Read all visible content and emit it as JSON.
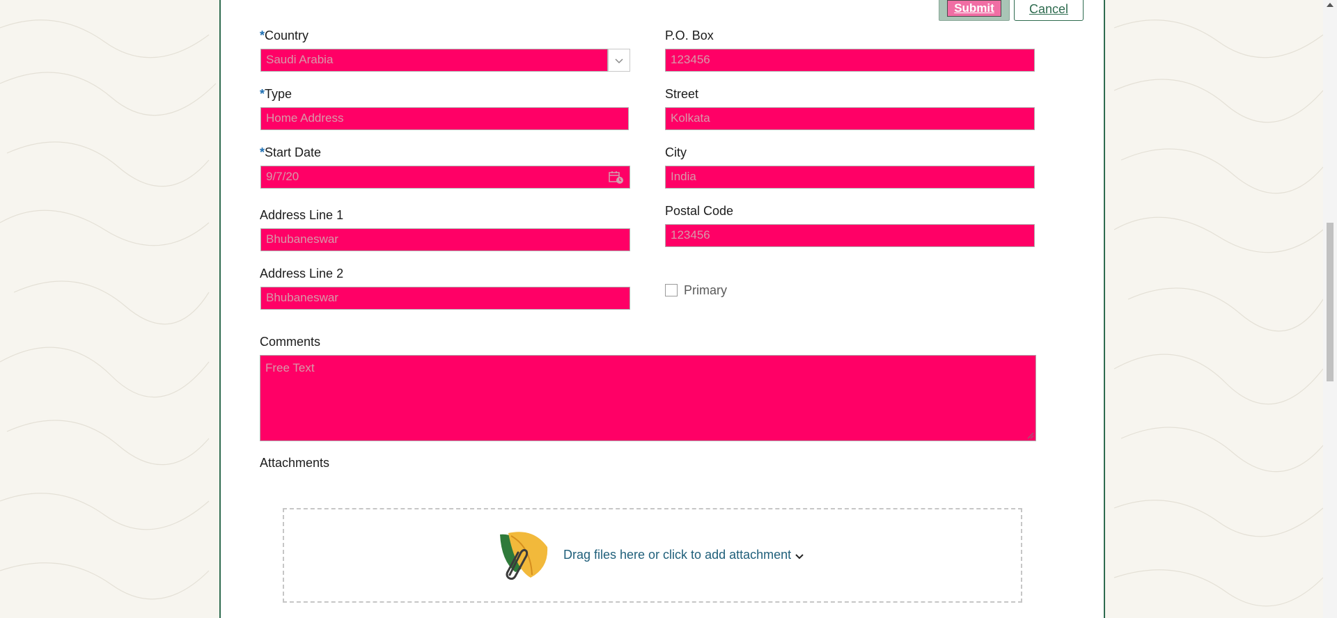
{
  "toolbar": {
    "submit_label": "Submit",
    "cancel_label": "Cancel"
  },
  "form": {
    "required_marker": "*",
    "country": {
      "label": "Country",
      "value": "Saudi Arabia"
    },
    "type": {
      "label": "Type",
      "value": "Home Address"
    },
    "start_date": {
      "label": "Start Date",
      "value": "9/7/20"
    },
    "address_line_1": {
      "label": "Address Line 1",
      "value": "Bhubaneswar"
    },
    "address_line_2": {
      "label": "Address Line 2",
      "value": "Bhubaneswar"
    },
    "po_box": {
      "label": "P.O. Box",
      "value": "123456"
    },
    "street": {
      "label": "Street",
      "value": "Kolkata"
    },
    "city": {
      "label": "City",
      "value": "India"
    },
    "postal_code": {
      "label": "Postal Code",
      "value": "123456"
    },
    "primary": {
      "label": "Primary",
      "checked": false
    },
    "comments": {
      "label": "Comments",
      "placeholder": "Free Text"
    },
    "attachments": {
      "label": "Attachments",
      "dropzone_text": "Drag files here or click to add attachment"
    }
  },
  "colors": {
    "field_bg": "#ff0066",
    "field_text": "#d79aa9",
    "accent": "#2e6b4f",
    "link": "#1f5f7a"
  },
  "icons": {
    "country_dropdown": "chevron-down-icon",
    "date_picker": "calendar-icon",
    "attachment": "leaf-paperclip-icon",
    "dropzone_menu": "chevron-down-icon"
  }
}
